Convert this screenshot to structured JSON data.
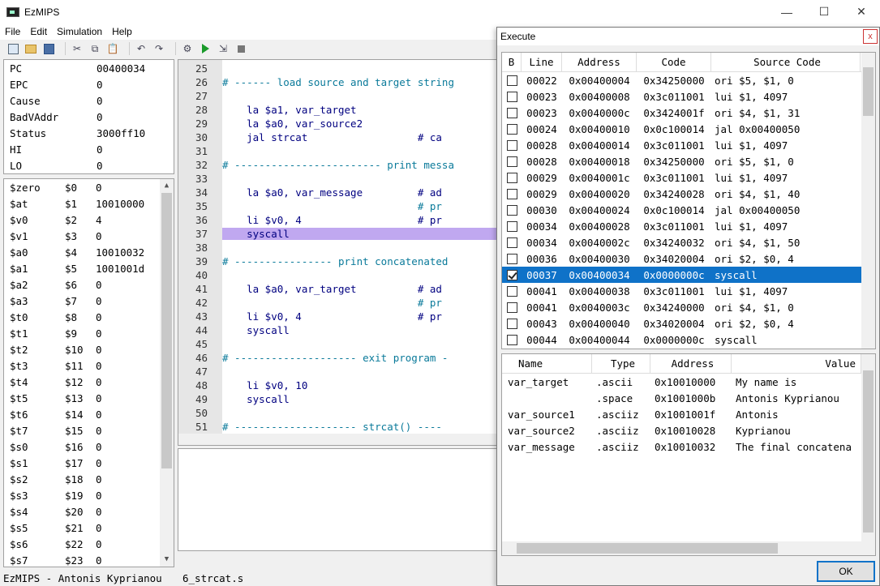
{
  "window": {
    "title": "EzMIPS",
    "min": "—",
    "max": "☐",
    "close": "✕"
  },
  "menu": [
    "File",
    "Edit",
    "Simulation",
    "Help"
  ],
  "special_registers": [
    {
      "name": "PC",
      "value": "00400034"
    },
    {
      "name": "EPC",
      "value": "0"
    },
    {
      "name": "Cause",
      "value": "0"
    },
    {
      "name": "BadVAddr",
      "value": "0"
    },
    {
      "name": "Status",
      "value": "3000ff10"
    },
    {
      "name": "HI",
      "value": "0"
    },
    {
      "name": "LO",
      "value": "0"
    }
  ],
  "gp_registers": [
    {
      "name": "$zero",
      "num": "$0",
      "value": "0"
    },
    {
      "name": "$at",
      "num": "$1",
      "value": "10010000"
    },
    {
      "name": "$v0",
      "num": "$2",
      "value": "4"
    },
    {
      "name": "$v1",
      "num": "$3",
      "value": "0"
    },
    {
      "name": "$a0",
      "num": "$4",
      "value": "10010032"
    },
    {
      "name": "$a1",
      "num": "$5",
      "value": "1001001d"
    },
    {
      "name": "$a2",
      "num": "$6",
      "value": "0"
    },
    {
      "name": "$a3",
      "num": "$7",
      "value": "0"
    },
    {
      "name": "$t0",
      "num": "$8",
      "value": "0"
    },
    {
      "name": "$t1",
      "num": "$9",
      "value": "0"
    },
    {
      "name": "$t2",
      "num": "$10",
      "value": "0"
    },
    {
      "name": "$t3",
      "num": "$11",
      "value": "0"
    },
    {
      "name": "$t4",
      "num": "$12",
      "value": "0"
    },
    {
      "name": "$t5",
      "num": "$13",
      "value": "0"
    },
    {
      "name": "$t6",
      "num": "$14",
      "value": "0"
    },
    {
      "name": "$t7",
      "num": "$15",
      "value": "0"
    },
    {
      "name": "$s0",
      "num": "$16",
      "value": "0"
    },
    {
      "name": "$s1",
      "num": "$17",
      "value": "0"
    },
    {
      "name": "$s2",
      "num": "$18",
      "value": "0"
    },
    {
      "name": "$s3",
      "num": "$19",
      "value": "0"
    },
    {
      "name": "$s4",
      "num": "$20",
      "value": "0"
    },
    {
      "name": "$s5",
      "num": "$21",
      "value": "0"
    },
    {
      "name": "$s6",
      "num": "$22",
      "value": "0"
    },
    {
      "name": "$s7",
      "num": "$23",
      "value": "0"
    }
  ],
  "editor_lines": [
    {
      "ln": "25",
      "text": ""
    },
    {
      "ln": "26",
      "text": "# ------ load source and target string"
    },
    {
      "ln": "27",
      "text": ""
    },
    {
      "ln": "28",
      "text": "    la $a1, var_target"
    },
    {
      "ln": "29",
      "text": "    la $a0, var_source2"
    },
    {
      "ln": "30",
      "text": "    jal strcat                  # ca"
    },
    {
      "ln": "31",
      "text": ""
    },
    {
      "ln": "32",
      "text": "# ------------------------ print messa"
    },
    {
      "ln": "33",
      "text": ""
    },
    {
      "ln": "34",
      "text": "    la $a0, var_message         # ad"
    },
    {
      "ln": "35",
      "text": "                                # pr"
    },
    {
      "ln": "36",
      "text": "    li $v0, 4                   # pr"
    },
    {
      "ln": "37",
      "text": "    syscall",
      "hl": true
    },
    {
      "ln": "38",
      "text": ""
    },
    {
      "ln": "39",
      "text": "# ---------------- print concatenated"
    },
    {
      "ln": "40",
      "text": ""
    },
    {
      "ln": "41",
      "text": "    la $a0, var_target          # ad"
    },
    {
      "ln": "42",
      "text": "                                # pr"
    },
    {
      "ln": "43",
      "text": "    li $v0, 4                   # pr"
    },
    {
      "ln": "44",
      "text": "    syscall"
    },
    {
      "ln": "45",
      "text": ""
    },
    {
      "ln": "46",
      "text": "# -------------------- exit program -"
    },
    {
      "ln": "47",
      "text": ""
    },
    {
      "ln": "48",
      "text": "    li $v0, 10"
    },
    {
      "ln": "49",
      "text": "    syscall"
    },
    {
      "ln": "50",
      "text": ""
    },
    {
      "ln": "51",
      "text": "# -------------------- strcat() ----"
    }
  ],
  "status": {
    "app": "EzMIPS - Antonis Kyprianou",
    "file": "6_strcat.s"
  },
  "dialog": {
    "title": "Execute",
    "close": "x",
    "exec_headers": [
      "B",
      "Line",
      "Address",
      "Code",
      "Source Code"
    ],
    "exec_rows": [
      {
        "checked": false,
        "line": "00022",
        "addr": "0x00400004",
        "code": "0x34250000",
        "src": "ori $5, $1, 0"
      },
      {
        "checked": false,
        "line": "00023",
        "addr": "0x00400008",
        "code": "0x3c011001",
        "src": "lui $1, 4097"
      },
      {
        "checked": false,
        "line": "00023",
        "addr": "0x0040000c",
        "code": "0x3424001f",
        "src": "ori $4, $1, 31"
      },
      {
        "checked": false,
        "line": "00024",
        "addr": "0x00400010",
        "code": "0x0c100014",
        "src": "jal 0x00400050"
      },
      {
        "checked": false,
        "line": "00028",
        "addr": "0x00400014",
        "code": "0x3c011001",
        "src": "lui $1, 4097"
      },
      {
        "checked": false,
        "line": "00028",
        "addr": "0x00400018",
        "code": "0x34250000",
        "src": "ori $5, $1, 0"
      },
      {
        "checked": false,
        "line": "00029",
        "addr": "0x0040001c",
        "code": "0x3c011001",
        "src": "lui $1, 4097"
      },
      {
        "checked": false,
        "line": "00029",
        "addr": "0x00400020",
        "code": "0x34240028",
        "src": "ori $4, $1, 40"
      },
      {
        "checked": false,
        "line": "00030",
        "addr": "0x00400024",
        "code": "0x0c100014",
        "src": "jal 0x00400050"
      },
      {
        "checked": false,
        "line": "00034",
        "addr": "0x00400028",
        "code": "0x3c011001",
        "src": "lui $1, 4097"
      },
      {
        "checked": false,
        "line": "00034",
        "addr": "0x0040002c",
        "code": "0x34240032",
        "src": "ori $4, $1, 50"
      },
      {
        "checked": false,
        "line": "00036",
        "addr": "0x00400030",
        "code": "0x34020004",
        "src": "ori $2, $0, 4"
      },
      {
        "checked": true,
        "selected": true,
        "line": "00037",
        "addr": "0x00400034",
        "code": "0x0000000c",
        "src": "syscall"
      },
      {
        "checked": false,
        "line": "00041",
        "addr": "0x00400038",
        "code": "0x3c011001",
        "src": "lui $1, 4097"
      },
      {
        "checked": false,
        "line": "00041",
        "addr": "0x0040003c",
        "code": "0x34240000",
        "src": "ori $4, $1, 0"
      },
      {
        "checked": false,
        "line": "00043",
        "addr": "0x00400040",
        "code": "0x34020004",
        "src": "ori $2, $0, 4"
      },
      {
        "checked": false,
        "line": "00044",
        "addr": "0x00400044",
        "code": "0x0000000c",
        "src": "syscall"
      }
    ],
    "data_headers": [
      "Name",
      "Type",
      "Address",
      "Value"
    ],
    "data_rows": [
      {
        "name": "var_target",
        "type": ".ascii",
        "addr": "0x10010000",
        "value": "My name is"
      },
      {
        "name": "",
        "type": ".space",
        "addr": "0x1001000b",
        "value": "Antonis Kyprianou"
      },
      {
        "name": "var_source1",
        "type": ".asciiz",
        "addr": "0x1001001f",
        "value": "Antonis"
      },
      {
        "name": "var_source2",
        "type": ".asciiz",
        "addr": "0x10010028",
        "value": "Kyprianou"
      },
      {
        "name": "var_message",
        "type": ".asciiz",
        "addr": "0x10010032",
        "value": "The final concatena"
      }
    ],
    "ok_label": "OK"
  }
}
